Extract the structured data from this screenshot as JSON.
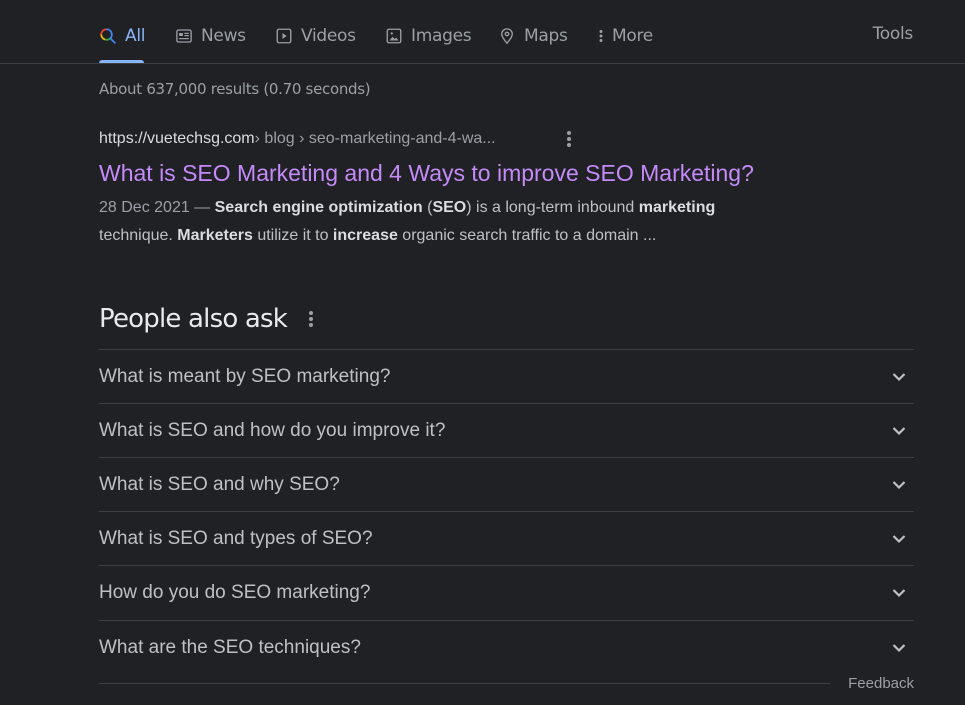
{
  "tabs": [
    {
      "label": "All",
      "icon": "search-icon",
      "active": true
    },
    {
      "label": "News",
      "icon": "news-icon"
    },
    {
      "label": "Videos",
      "icon": "video-icon"
    },
    {
      "label": "Images",
      "icon": "image-icon"
    },
    {
      "label": "Maps",
      "icon": "map-pin-icon"
    },
    {
      "label": "More",
      "icon": "more-vert-icon"
    }
  ],
  "tools_label": "Tools",
  "result_stats": "About 637,000 results (0.70 seconds)",
  "result": {
    "cite_domain": "https://vuetechsg.com",
    "cite_path": " › blog › seo-marketing-and-4-wa...",
    "title": "What is SEO Marketing and 4 Ways to improve SEO Marketing?",
    "snippet": {
      "date": "28 Dec 2021 — ",
      "parts": [
        {
          "text": "Search engine optimization",
          "bold": true
        },
        {
          "text": " (",
          "bold": false
        },
        {
          "text": "SEO",
          "bold": true
        },
        {
          "text": ") is a long-term inbound ",
          "bold": false
        },
        {
          "text": "marketing",
          "bold": true
        },
        {
          "text": " technique. ",
          "bold": false
        },
        {
          "text": "Marketers",
          "bold": true
        },
        {
          "text": " utilize it to ",
          "bold": false
        },
        {
          "text": "increase",
          "bold": true
        },
        {
          "text": " organic search traffic to a domain ...",
          "bold": false
        }
      ]
    }
  },
  "people_also_ask": {
    "title": "People also ask",
    "questions": [
      "What is meant by SEO marketing?",
      "What is SEO and how do you improve it?",
      "What is SEO and why SEO?",
      "What is SEO and types of SEO?",
      "How do you do SEO marketing?",
      "What are the SEO techniques?"
    ]
  },
  "feedback_label": "Feedback",
  "colors": {
    "background": "#202124",
    "accent": "#8ab4f8",
    "visited_link": "#c58af9",
    "text": "#bdc1c6",
    "muted": "#9aa0a6",
    "divider": "#3c4043"
  }
}
